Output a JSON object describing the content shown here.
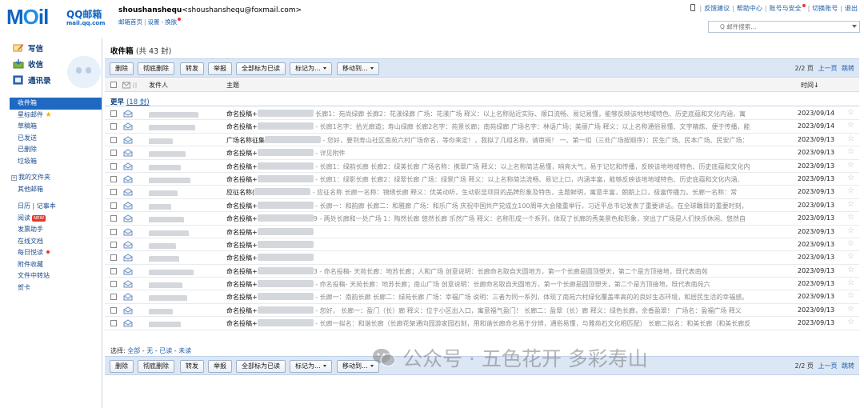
{
  "logo": {
    "brand": "MOil",
    "name": "QQ邮箱",
    "domain": "mail.qq.com"
  },
  "user": {
    "name": "shoushanshequ",
    "email": "<shoushanshequ@foxmail.com>",
    "links": [
      "邮箱首页",
      "设置",
      "换肤"
    ]
  },
  "top_links": [
    "反馈建议",
    "帮助中心",
    "账号与安全",
    "切换账号",
    "退出"
  ],
  "search": {
    "placeholder": "Q 邮件搜索..."
  },
  "quick": {
    "write": "写信",
    "inbox": "收信",
    "contacts": "通讯录"
  },
  "folders": {
    "inbox": "收件箱",
    "starred": "星标邮件",
    "drafts": "草稿箱",
    "sent": "已发送",
    "deleted": "已删除",
    "spam": "垃圾箱",
    "my_folders": "我的文件夹",
    "other": "其他邮箱",
    "calendar": "日历 | 记事本",
    "reading": "阅读",
    "reading_badge": "NEW",
    "invoice": "发票助手",
    "docs": "在线文档",
    "daily": "每日悦读",
    "attachments": "附件收藏",
    "transfer": "文件中转站",
    "cards": "贺卡"
  },
  "inbox": {
    "title": "收件箱",
    "count": "(共 43 封)"
  },
  "toolbar": {
    "delete": "删除",
    "perm_delete": "彻底删除",
    "forward": "转发",
    "report": "举报",
    "mark_all_read": "全部标为已读",
    "mark_as": "标记为...",
    "move_to": "移动到..."
  },
  "pager": {
    "page": "2/2 页",
    "prev": "上一页",
    "jump": "跳转"
  },
  "columns": {
    "sender": "发件人",
    "subject": "主题",
    "time": "时间↓"
  },
  "group": {
    "label": "更早",
    "count": "(18 封)"
  },
  "mails": [
    {
      "title": "命名投稿+",
      "preview": " 长廊1：苑尚绿廊 长廊2：花漾绿廊 广场：花漾广场 释义：以上名称贴近实际、顺口流畅、易记易懂，能够反映该地地域特色、历史底蕴和文化内涵，寓",
      "time": "2023/09/14"
    },
    {
      "title": "命名投稿+",
      "preview": " - 长廊1名字：拾光廊道；寿山绿廊 长廊2名字：苑景长廊；南苑绿廊 广场名字：林语广场；美丽广场 释义：以上名称通俗易懂、文字精炼、便于传播，能",
      "time": "2023/09/14"
    },
    {
      "title": "广场名称征集",
      "preview": " - 您好，要到寿山社区南苑六村广场命名，等你来定！，我拟了几组名称，请审阅！  一、第一组（三处广场按顺序）：民生广场、民本广场、民安广场：",
      "time": "2023/09/13"
    },
    {
      "title": "命名投稿+",
      "preview": " - 详见附件",
      "time": "2023/09/13"
    },
    {
      "title": "命名投稿+",
      "preview": " - 长廊1：绿韵长廊 长廊2：绿美长廊 广场名称：携翠广场 释义：以上名称简洁易懂，响亮大气，易于记忆和传播，反映该地地域特色、历史底蕴和文化内",
      "time": "2023/09/13"
    },
    {
      "title": "命名投稿+",
      "preview": " - 长廊1：绿影长廊 长廊2：绿翠长廊 广场：绿景广场 释义：以上名称简洁流畅、易记上口，内涵丰富，能够反映该地地域特色、历史底蕴和文化内涵、",
      "time": "2023/09/13"
    },
    {
      "title": "应征名称(",
      "preview": " - 应征名称 长廊一名称：锦绣长廊 释义：优美动听，生动彰显项目的品牌形象及特色，主题鲜明，寓意丰富，朗朗上口，极富传播力。长廊一名称：常",
      "time": "2023/09/13"
    },
    {
      "title": "命名投稿+",
      "preview": " - 长廊一：和韵廊 长廊二：和雅廊 广场：和乐广场 庆祝中国共产党成立100周年大会隆重举行，习近平总书记发表了重要讲话。在全球瞩目的重要时刻，",
      "time": "2023/09/13"
    },
    {
      "title": "命名投稿+",
      "preview": "9 - 两处长廊和一处广场 1：陶然长廊 悠然长廊 乐然广场 释义：名称形成一个系列，体现了长廊的秀美景色和形象，突出了广场是人们快乐休闲、悠然自",
      "time": "2023/09/13"
    },
    {
      "title": "命名投稿+",
      "preview": "",
      "time": "2023/09/13"
    },
    {
      "title": "命名投稿+",
      "preview": "",
      "time": "2023/09/13"
    },
    {
      "title": "命名投稿+",
      "preview": "",
      "time": "2023/09/13"
    },
    {
      "title": "命名投稿+",
      "preview": "3 - 命名投稿-  天苑长廊：地苏长廊；人和广场 创意说明：长廊命名取自天圆地方，第一个长廊是圆顶塑天，第二个是方顶接地，既代表南苑",
      "time": "2023/09/13"
    },
    {
      "title": "命名投稿+",
      "preview": " - 命名投稿- 天苑长廊：地苏长廊；南山广场 创意说明：长廊命名取自天圆地方，第一个长廊是圆顶塑天，第二个是方顶接地，既代表南苑六",
      "time": "2023/09/13"
    },
    {
      "title": "命名投稿+",
      "preview": " - 长廊一：南韵长廊 长廊二：绿苑长廊 广场：幸福广场 说明：三者为同一系列，体现了南苑六村绿化覆盖率高的的良好生态环境，和居民生活的幸福感。",
      "time": "2023/09/13"
    },
    {
      "title": "命名投稿+",
      "preview": " - 您好，  长廊一：盈门（长）廊 释义：位于小区出入口，寓意福气盈门！ 长廊二：盈翠（长）廊 释义：绿色长廊，余香盈翠！  广场名：盈福广场 释义",
      "time": "2023/09/13"
    },
    {
      "title": "命名投稿+",
      "preview": " - 长廊一拟名：和谐长廊（长廊花架通向园游家园石刻，用和谐长廊命名易于分辨，通俗易懂，与雅苑石文化相匹配） 长廊二拟名：和美长廊（和美长廊反",
      "time": "2023/09/13"
    }
  ],
  "select_line": {
    "label": "选择:",
    "all": "全部",
    "none": "无",
    "read": "已读",
    "unread": "未读"
  },
  "watermark": {
    "text": "公众号 · 五色花开 多彩寿山"
  },
  "colors": {
    "accent": "#1f69c3",
    "toolbar": "#dce7f5",
    "link": "#1d5ea8",
    "new_badge": "#e23a2e"
  }
}
